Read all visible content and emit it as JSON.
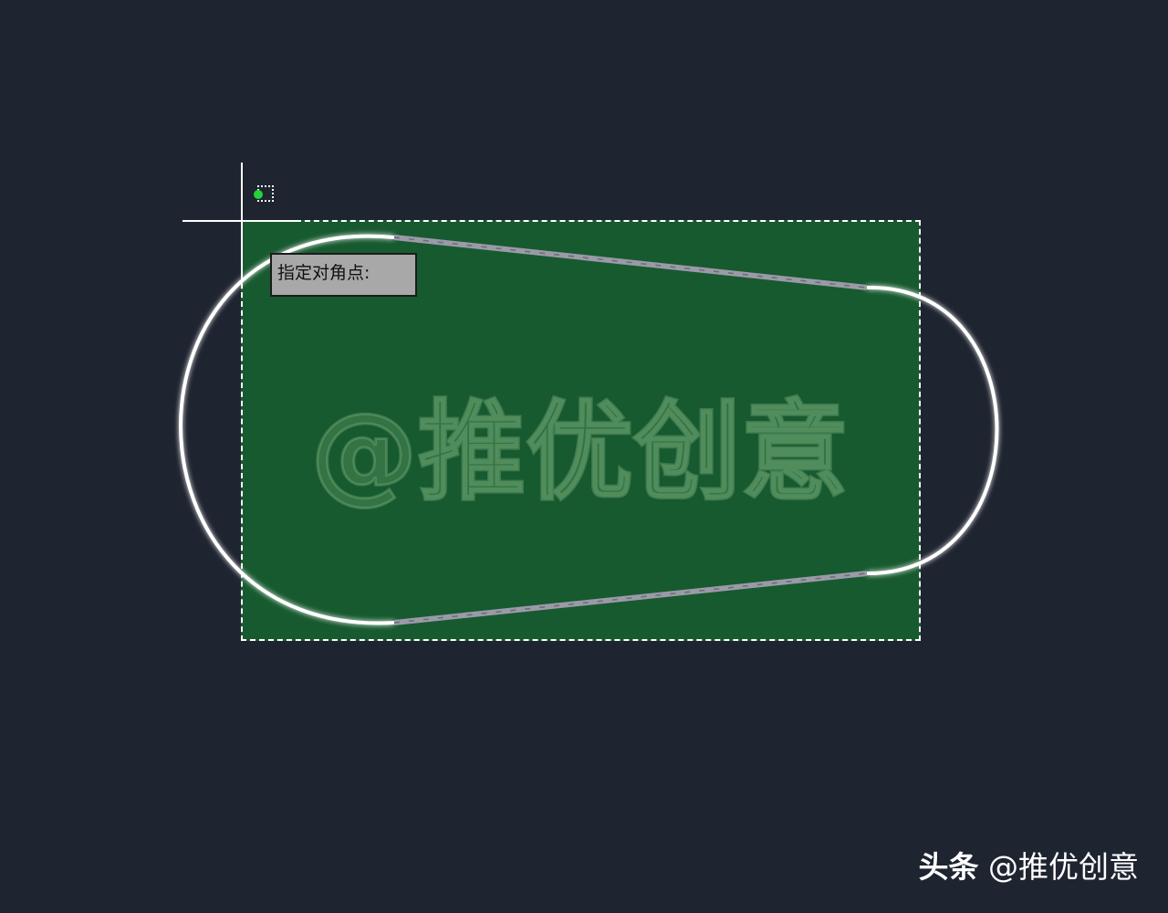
{
  "canvas": {
    "background_color": "#1e2430",
    "selection_color": "#175a2f"
  },
  "prompt": {
    "text": "指定对角点:"
  },
  "watermark": {
    "center_text": "@推优创意",
    "corner_platform": "头条",
    "corner_text": "@推优创意"
  },
  "icons": {
    "snap": "snap-endpoint-icon",
    "cursor": "crosshair-icon"
  }
}
